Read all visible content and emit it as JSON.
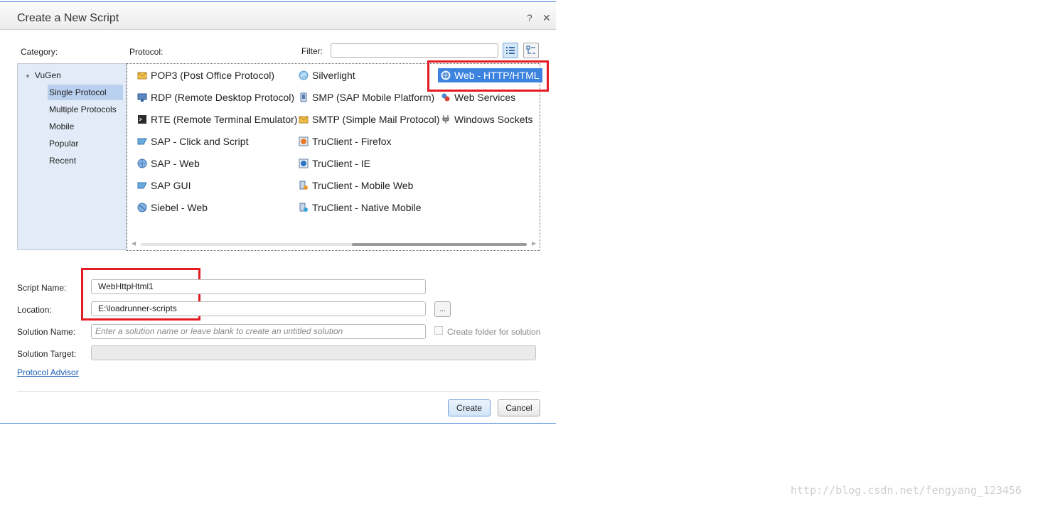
{
  "dialog": {
    "title": "Create a New Script",
    "help_label": "?",
    "close_label": "✕"
  },
  "labels": {
    "category": "Category:",
    "protocol": "Protocol:",
    "filter": "Filter:"
  },
  "filter": {
    "value": ""
  },
  "category": {
    "root": "VuGen",
    "items": [
      "Single Protocol",
      "Multiple Protocols",
      "Mobile",
      "Popular",
      "Recent"
    ],
    "selected": "Single Protocol"
  },
  "protocols": {
    "columns": [
      [
        "POP3 (Post Office Protocol)",
        "RDP (Remote Desktop Protocol)",
        "RTE (Remote Terminal Emulator)",
        "SAP - Click and Script",
        "SAP - Web",
        "SAP GUI",
        "Siebel - Web"
      ],
      [
        "Silverlight",
        "SMP (SAP Mobile Platform)",
        "SMTP (Simple Mail Protocol)",
        "TruClient - Firefox",
        "TruClient - IE",
        "TruClient - Mobile Web",
        "TruClient - Native Mobile"
      ],
      [
        "Web - HTTP/HTML",
        "Web Services",
        "Windows Sockets"
      ]
    ],
    "selected": "Web - HTTP/HTML"
  },
  "form": {
    "script_name_label": "Script Name:",
    "script_name_value": "WebHttpHtml1",
    "location_label": "Location:",
    "location_value": "E:\\loadrunner-scripts",
    "browse_label": "...",
    "solution_name_label": "Solution Name:",
    "solution_name_placeholder": "Enter a solution name or leave blank to create an untitled solution",
    "create_folder_label": "Create folder for solution",
    "solution_target_label": "Solution Target:",
    "solution_target_value": ""
  },
  "protocol_advisor_link": "Protocol Advisor",
  "buttons": {
    "create": "Create",
    "cancel": "Cancel"
  },
  "watermark": "http://blog.csdn.net/fengyang_123456"
}
